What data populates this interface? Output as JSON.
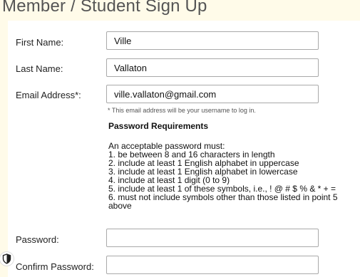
{
  "page": {
    "title": "Member / Student Sign Up"
  },
  "form": {
    "first_name": {
      "label": "First Name:",
      "value": "Ville"
    },
    "last_name": {
      "label": "Last Name:",
      "value": "Vallaton"
    },
    "email": {
      "label": "Email Address*:",
      "value": "ville.vallaton@gmail.com",
      "hint": "* This email address will be your username to log in."
    },
    "password_requirements": {
      "heading": "Password Requirements",
      "intro": "An acceptable password must:",
      "rules": [
        "1. be between 8 and 16 characters in length",
        "2. include at least 1 English alphabet in uppercase",
        "3. include at least 1 English alphabet in lowercase",
        "4. include at least 1 digit (0 to 9)",
        "5. include at least 1 of these symbols, i.e., ! @ # $ % & * + =",
        "6. must not include symbols other than those listed in point 5",
        "above"
      ]
    },
    "password": {
      "label": "Password:",
      "value": ""
    },
    "confirm_password": {
      "label": "Confirm Password:",
      "value": ""
    }
  },
  "icons": {
    "shield": "shield-icon"
  }
}
